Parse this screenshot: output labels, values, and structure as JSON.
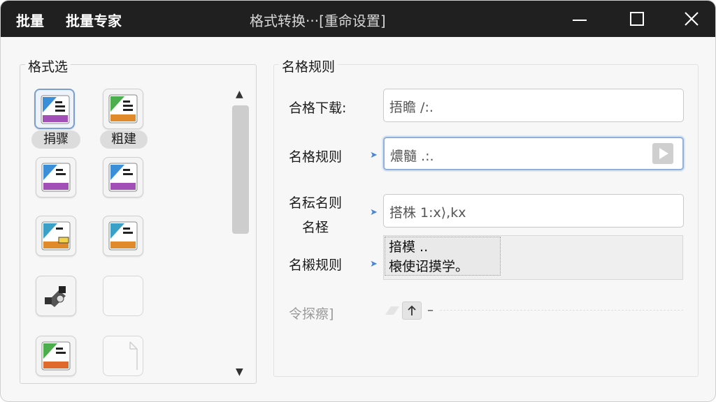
{
  "titlebar": {
    "menu": [
      "批量",
      "批量专家"
    ],
    "title": "格式转换···[重命设置]",
    "controls": [
      "minimize-icon",
      "maximize-icon",
      "close-icon"
    ]
  },
  "left_panel": {
    "label": "格式选",
    "tiles": [
      {
        "label": "捐骤",
        "icon": "document-blue-purple-icon",
        "selected": true
      },
      {
        "label": "粗建",
        "icon": "document-green-orange-icon",
        "selected": false
      },
      {
        "label": "",
        "icon": "document-blue-purple-icon"
      },
      {
        "label": "",
        "icon": "document-blue-purple-icon"
      },
      {
        "label": "",
        "icon": "document-green-orange-icon"
      },
      {
        "label": "",
        "icon": "document-green-orange-icon"
      },
      {
        "label": "",
        "icon": "puzzle-gear-icon"
      },
      {
        "label": "",
        "icon": "blank-icon"
      },
      {
        "label": "",
        "icon": "document-green-orange-icon"
      },
      {
        "label": "",
        "icon": "blank-page-icon"
      }
    ]
  },
  "right_panel": {
    "label": "名格规则",
    "rows": [
      {
        "label": "合格下载:",
        "value": "捂瞻 /:."
      },
      {
        "label": "名格规则",
        "value": "燶髓 .:."
      },
      {
        "label_line1": "名秐名则",
        "label_line2": "名柽",
        "value": "搭株 1:x⟩,kx"
      },
      {
        "label": "名樧规则",
        "text_line1": "揞模 ..",
        "text_line2": "榱使诏摸学。"
      }
    ],
    "footer_label": "令探瘵]"
  },
  "colors": {
    "titlebar": "#202020",
    "accent": "#8fb0dd",
    "pointer": "#4a86d6"
  }
}
